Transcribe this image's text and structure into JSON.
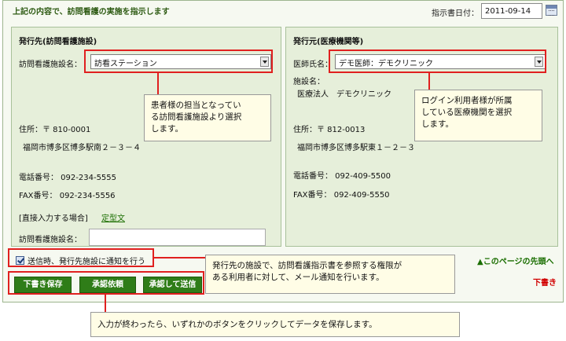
{
  "header": {
    "instruction": "上記の内容で、訪問看護の実施を指示します",
    "date_label": "指示書日付：",
    "date_value": "2011-09-14"
  },
  "issuer_to": {
    "title": "発行先(訪問看護施設)",
    "facility_label": "訪問看護施設名：",
    "facility_selected": "訪看ステーション",
    "address_label": "住所：〒 810-0001",
    "address_line": "福岡市博多区博多駅南２－３－４",
    "phone": "電話番号： 092-234-5555",
    "fax": "FAX番号： 092-234-5556",
    "direct_input_label": "[直接入力する場合]",
    "template_link": "定型文",
    "direct_name_label": "訪問看護施設名：",
    "direct_name_value": ""
  },
  "issuer_from": {
    "title": "発行元(医療機関等)",
    "doctor_label": "医師氏名：",
    "doctor_selected": "デモ医師：デモクリニック",
    "facility_label": "施設名：",
    "facility_name": "医療法人　デモクリニック",
    "address_label": "住所：〒 812-0013",
    "address_line": "福岡市博多区博多駅東１－２－３",
    "phone": "電話番号： 092-409-5500",
    "fax": "FAX番号： 092-409-5550"
  },
  "callouts": {
    "patient_facility": [
      "患者様の担当となってい",
      "る訪問看護施設より選択",
      "します。"
    ],
    "login_clinic": [
      "ログイン利用者様が所属",
      "している医療機関を選択",
      "します。"
    ],
    "notify_help": [
      "発行先の施設で、訪問看護指示書を参照する権限が",
      "ある利用者に対して、メール通知を行います。"
    ],
    "save_help": "入力が終わったら、いずれかのボタンをクリックしてデータを保存します。"
  },
  "notify": {
    "label": "送信時、発行先施設に通知を行う",
    "checked": true
  },
  "buttons": {
    "draft_save": "下書き保存",
    "request_approval": "承認依頼",
    "approve_send": "承認して送信"
  },
  "links": {
    "page_top": "▲このページの先頭へ"
  },
  "status": {
    "draft": "下書き"
  },
  "colors": {
    "accent_green": "#2f7d18",
    "highlight_red": "#e0201f",
    "panel_bg": "#e6efda",
    "callout_bg": "#fffde6"
  }
}
